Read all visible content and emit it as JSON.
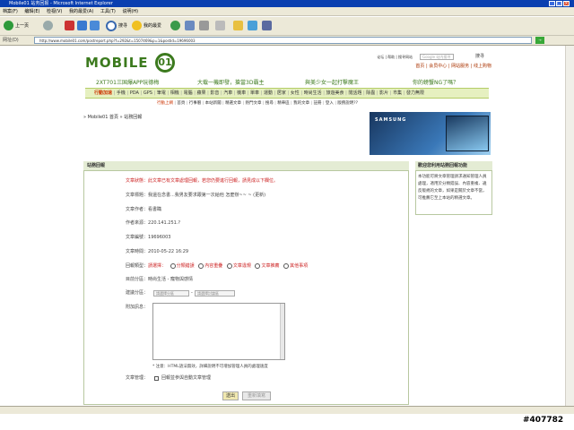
{
  "window": {
    "title": "Mobile01 站务回报 - Microsoft Internet Explorer",
    "menu": [
      "档案(F)",
      "编辑(E)",
      "检视(V)",
      "我的最爱(A)",
      "工具(T)",
      "说明(H)"
    ],
    "toolbar": {
      "back": "上一页",
      "search": "搜寻",
      "favorites": "我的最爱"
    },
    "address_label": "网址(D)",
    "address": "http://www.mobile01.com/postreport.php?f=292&t=1507469&p=1&postid=19696003",
    "go": "→"
  },
  "site": {
    "logo": "MOBILE",
    "logo_mark": "01",
    "topnav": "论坛 | 帮助 | 搜寻网站",
    "search_placeholder": "Google 站内搜寻",
    "search_button": "搜寻",
    "userlinks": "首页 | 会员中心 | 网站服务 | 线上购物",
    "promo": [
      "2XT701三国爆APP玩德梅",
      "大载一機即發，搶當3D霸主",
      "與美少女一起打擊魔王",
      "你的螃蟹NG了嗎？"
    ],
    "catnav": [
      "行動加速",
      "手機",
      "PDA",
      "GPS",
      "筆電",
      "相機",
      "電腦",
      "蘋果",
      "影音",
      "汽車",
      "機車",
      "單車",
      "運動",
      "居家",
      "女性",
      "時尚生活",
      "旅遊美食",
      "閒話題",
      "除蟲",
      "影片",
      "市集",
      "發力無限"
    ],
    "subnav": [
      "行動上網",
      "首頁",
      "行事曆",
      "本站新聞",
      "精選文章",
      "熱門文章",
      "搜尋",
      "精華區",
      "我的文章",
      "註冊",
      "登入",
      "版務說明??"
    ],
    "breadcrumb": "» Mobile01 首頁 » 站務回報",
    "banner_brand": "SAMSUNG"
  },
  "form": {
    "title": "站務回報",
    "warning": "文章狀態：此文章已有文章處理回報，若您仍要進行回報，請見成以下欄位。",
    "subject_label": "文章標題：",
    "subject": "我還在念書...我男友要求跟第一次給他 怎麼辦~~ ~ (更新)",
    "author_label": "文章作者：",
    "author": "看書瞞",
    "ip_label": "作者來源：",
    "ip": "220.141.251.?",
    "id_label": "文章編號：",
    "id": "19696003",
    "time_label": "文章時間：",
    "time": "2010-05-22 16:29",
    "category_label": "回報類型：",
    "category_required": "請選擇：",
    "categories": [
      "分類錯誤",
      "內容重疊",
      "文章違規",
      "文章推薦",
      "其他事項"
    ],
    "current_forum_label": "目前分區：",
    "current_forum": "時尚生活 - 寵物與感情",
    "move_label": "建議分區：",
    "move_select1": "請選擇分區",
    "move_select2": "請選擇討論區",
    "attach_label": "附加訊息：",
    "note": "* 注意：HTML語法無效，詳細說明不可增加管理人員的處理速度",
    "manage_label": "文章管理：",
    "manage_check": "回報並參與自動文章管理",
    "submit": "送出",
    "reset": "重新填寫"
  },
  "side": {
    "title": "歡迎您利用站務回報功能",
    "body": "本功能可將文章管理請求通知管理人員處理，適用於分類錯誤、內容重複、違反版規的文章，如果是關於文章不當，可推薦它至上本站的精選文章。"
  },
  "watermark": "#407782"
}
